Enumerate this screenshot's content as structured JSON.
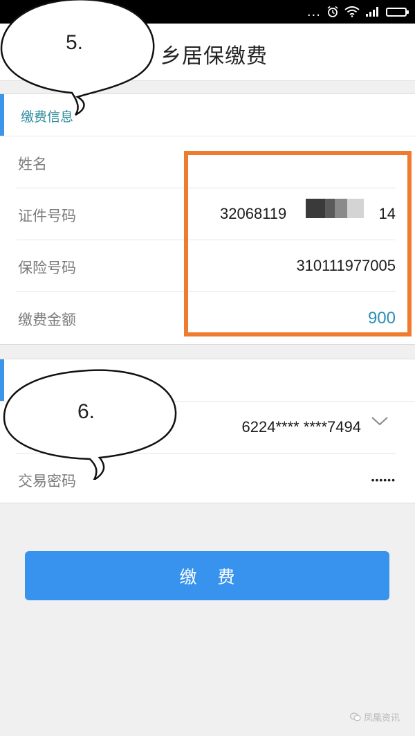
{
  "status_bar": {
    "dots": "...",
    "icons": [
      "alarm-icon",
      "wifi-icon",
      "signal-icon",
      "battery-icon"
    ]
  },
  "header": {
    "title": "乡居保缴费"
  },
  "payment_info": {
    "section_label": "缴费信息",
    "rows": [
      {
        "label": "姓名",
        "value": ""
      },
      {
        "label": "证件号码",
        "value_prefix": "32068119",
        "value_suffix": "14"
      },
      {
        "label": "保险号码",
        "value": "310111977005"
      },
      {
        "label": "缴费金额",
        "value": "900"
      }
    ]
  },
  "account": {
    "card_number": "6224**** ****7494",
    "password_label": "交易密码",
    "password_value": "••••••"
  },
  "annotations": {
    "bubble_5": "5.",
    "bubble_6": "6."
  },
  "pay_button": {
    "label": "缴费"
  },
  "watermark": {
    "text": "凤凰资讯"
  },
  "colors": {
    "accent": "#3b95e9",
    "button": "#3893ee",
    "amount": "#2b8eb3",
    "highlight_box": "#ef7b2e"
  }
}
